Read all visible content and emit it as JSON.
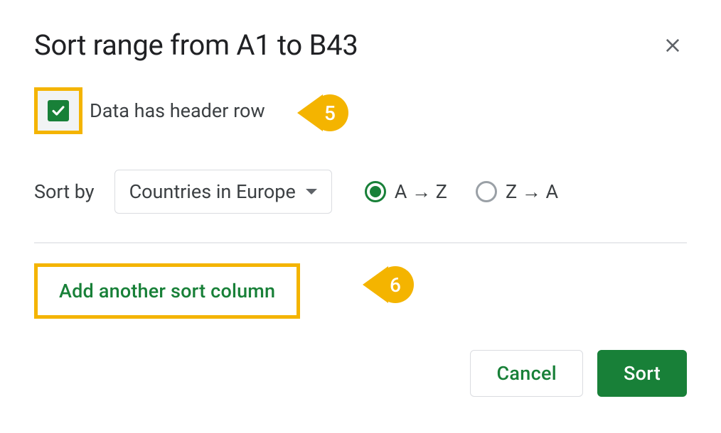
{
  "dialog": {
    "title": "Sort range from A1 to B43"
  },
  "header_checkbox": {
    "label": "Data has header row",
    "checked": true
  },
  "sort": {
    "label": "Sort by",
    "selected_column": "Countries in Europe",
    "order_asc_label": "A → Z",
    "order_desc_label": "Z → A",
    "order": "asc"
  },
  "add_column": {
    "label": "Add another sort column"
  },
  "buttons": {
    "cancel": "Cancel",
    "sort": "Sort"
  },
  "callouts": {
    "five": "5",
    "six": "6"
  },
  "colors": {
    "accent": "#188038",
    "highlight": "#f4b400"
  }
}
